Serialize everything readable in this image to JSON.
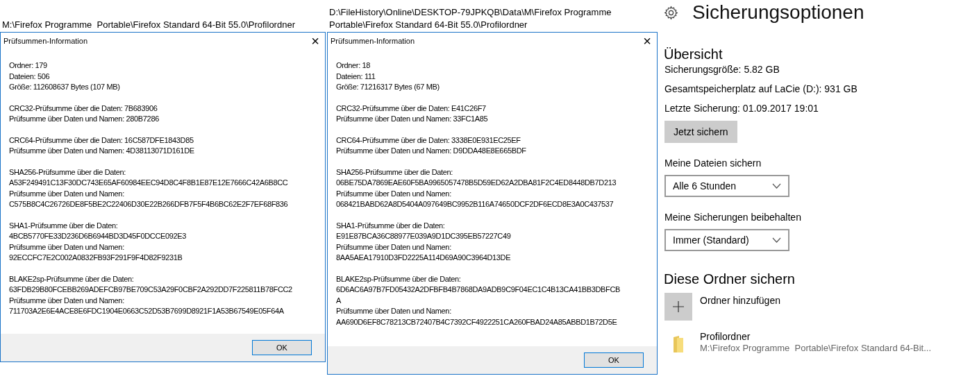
{
  "checksum_windows": [
    {
      "path_lines": [
        "M:\\Firefox Programme  Portable\\Firefox Standard 64-Bit 55.0\\Profilordner"
      ],
      "dialog": {
        "title": "Prüfsummen-Information",
        "close": "×",
        "groups": [
          [
            "Ordner: 179",
            "Dateien: 506",
            "Größe: 112608637 Bytes (107 MB)"
          ],
          [
            "CRC32-Prüfsumme über die Daten: 7B683906",
            "Prüfsumme über Daten und Namen: 280B7286"
          ],
          [
            "CRC64-Prüfsumme über die Daten: 16C587DFE1843D85",
            "Prüfsumme über Daten und Namen: 4D38113071D161DE"
          ],
          [
            "SHA256-Prüfsumme über die Daten:",
            "A53F249491C13F30DC743E65AF60984EEC94D8C4F8B1E87E12E7666C42A6B8CC",
            "Prüfsumme über Daten und Namen:",
            "C575B8C4C26726DE8F5BE2C22406D30E22B266DFB7F5F4B6BC62E2F7EF68F836"
          ],
          [
            "SHA1-Prüfsumme über die Daten:",
            "4BCB5770FE33D236D6B6944BD3D45F0DCCE092E3",
            "Prüfsumme über Daten und Namen:",
            "92ECCFC7E2C002A0832FB93F291F9F4D82F9231B"
          ],
          [
            "BLAKE2sp-Prüfsumme über die Daten:",
            "63FDB29B80FCEBB269ADEFCB97BE709C53A29F0CBF2A292DD7F225811B78FCC2",
            "Prüfsumme über Daten und Namen:",
            "711703A2E6E4ACE8E6FDC1904E0663C52D53B7699D8921F1A53B67549E05F64A"
          ]
        ],
        "button": "OK"
      }
    },
    {
      "path_lines": [
        "D:\\FileHistory\\Online\\DESKTOP-79JPKQB\\Data\\M\\Firefox Programme",
        "Portable\\Firefox Standard 64-Bit 55.0\\Profilordner"
      ],
      "dialog": {
        "title": "Prüfsummen-Information",
        "close": "×",
        "groups": [
          [
            "Ordner: 18",
            "Dateien: 111",
            "Größe: 71216317 Bytes (67 MB)"
          ],
          [
            "CRC32-Prüfsumme über die Daten: E41C26F7",
            "Prüfsumme über Daten und Namen: 33FC1A85"
          ],
          [
            "CRC64-Prüfsumme über die Daten: 3338E0E931EC25EF",
            "Prüfsumme über Daten und Namen: D9DDA48E8E665BDF"
          ],
          [
            "SHA256-Prüfsumme über die Daten:",
            "06BE75DA7869EAE60F5BA9965057478B5D59ED62A2DBA81F2C4ED8448DB7D213",
            "Prüfsumme über Daten und Namen:",
            "068421BABD62A8D5404A097649BC9952B116A74650DCF2DF6ECD8E3A0C437537"
          ],
          [
            "SHA1-Prüfsumme über die Daten:",
            "E91E87BCA36C88977E039A9D1DC395EB57227C49",
            "Prüfsumme über Daten und Namen:",
            "8AA5AEA17910D3FD2225A114D69A90C3964D13DE"
          ],
          [
            "BLAKE2sp-Prüfsumme über die Daten:",
            "6D6AC6A97B7FD05432A2DFBFB4B7868DA9ADB9C9F04EC1C4B13CA41BB3DBFCB",
            "A",
            "Prüfsumme über Daten und Namen:",
            "AA690D6EF8C78213CB72407B4C7392CF4922251CA260FBAD24A85ABBD1B72D5E"
          ]
        ],
        "button": "OK"
      }
    }
  ],
  "backup_options": {
    "title": "Sicherungsoptionen",
    "overview": {
      "heading": "Übersicht",
      "facts": [
        "Sicherungsgröße: 5.82 GB",
        "Gesamtspeicherplatz auf LaCie (D:): 931 GB",
        "Letzte Sicherung: 01.09.2017 19:01"
      ],
      "button": "Jetzt sichern"
    },
    "settings": [
      {
        "label": "Meine Dateien sichern",
        "value": "Alle 6 Stunden"
      },
      {
        "label": "Meine Sicherungen beibehalten",
        "value": "Immer (Standard)"
      }
    ],
    "folders": {
      "heading": "Diese Ordner sichern",
      "add_label": "Ordner hinzufügen",
      "items": [
        {
          "name": "Profilordner",
          "path": "M:\\Firefox Programme  Portable\\Firefox Standard 64-Bit..."
        }
      ]
    }
  }
}
